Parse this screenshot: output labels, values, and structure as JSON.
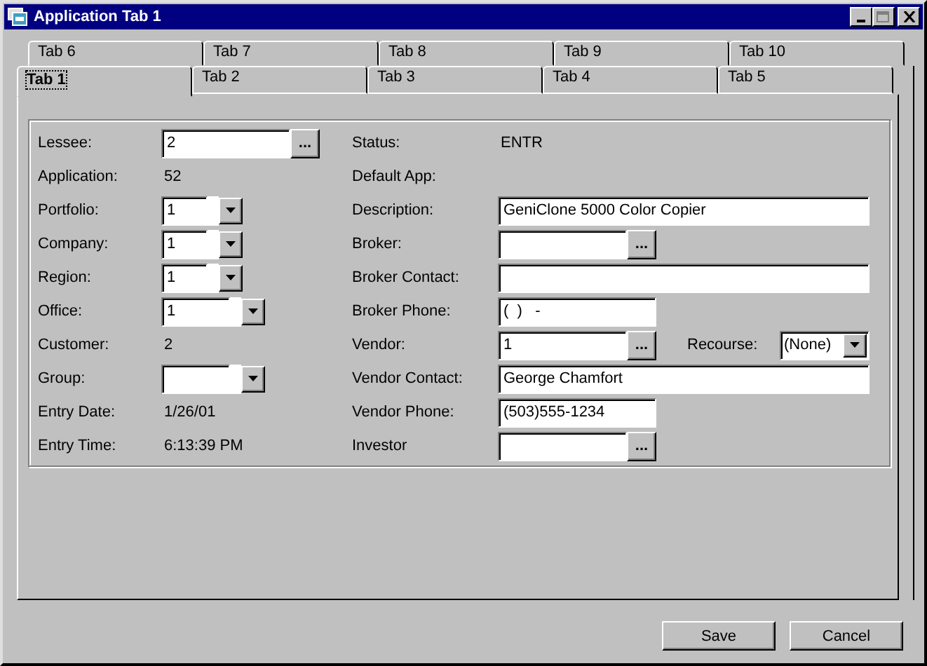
{
  "window": {
    "title": "Application Tab 1"
  },
  "tab_rows": [
    [
      {
        "label": "Tab 6",
        "selected": false
      },
      {
        "label": "Tab 7",
        "selected": false
      },
      {
        "label": "Tab 8",
        "selected": false
      },
      {
        "label": "Tab 9",
        "selected": false
      },
      {
        "label": "Tab 10",
        "selected": false
      }
    ],
    [
      {
        "label": "Tab 1",
        "selected": true
      },
      {
        "label": "Tab 2",
        "selected": false
      },
      {
        "label": "Tab 3",
        "selected": false
      },
      {
        "label": "Tab 4",
        "selected": false
      },
      {
        "label": "Tab 5",
        "selected": false
      }
    ]
  ],
  "left_fields": [
    {
      "label": "Lessee:",
      "kind": "lookup",
      "value": "2",
      "button": "..."
    },
    {
      "label": "Application:",
      "kind": "value",
      "value": "52"
    },
    {
      "label": "Portfolio:",
      "kind": "combo",
      "value": "1"
    },
    {
      "label": "Company:",
      "kind": "combo",
      "value": "1"
    },
    {
      "label": "Region:",
      "kind": "combo",
      "value": "1"
    },
    {
      "label": "Office:",
      "kind": "wide-combo",
      "value": "1"
    },
    {
      "label": "Customer:",
      "kind": "value",
      "value": "2"
    },
    {
      "label": "Group:",
      "kind": "wide-combo"
    },
    {
      "label": "Entry Date:",
      "kind": "value",
      "value": "1/26/01"
    },
    {
      "label": "Entry Time:",
      "kind": "value",
      "value": "6:13:39 PM"
    }
  ],
  "right_fields": [
    {
      "label": "Status:",
      "kind": "value",
      "value": "ENTR"
    },
    {
      "label": "Default App:",
      "kind": "value"
    },
    {
      "label": "Description:",
      "kind": "long-field",
      "value": "GeniClone 5000 Color Copier"
    },
    {
      "label": "Broker:",
      "kind": "lookup",
      "button": "..."
    },
    {
      "label": "Broker Contact:",
      "kind": "long-field"
    },
    {
      "label": "Broker Phone:",
      "kind": "short-field",
      "value": "(  )   -"
    },
    {
      "label": "Vendor:",
      "kind": "lookup",
      "value": "1",
      "button": "...",
      "extra": {
        "label": "Recourse:",
        "value": "(None)"
      }
    },
    {
      "label": "Vendor Contact:",
      "kind": "long-field",
      "value": "George Chamfort"
    },
    {
      "label": "Vendor Phone:",
      "kind": "short-field",
      "value": "(503)555-1234"
    },
    {
      "label": "Investor",
      "kind": "lookup",
      "button": "..."
    }
  ],
  "buttons": [
    "Save",
    "Cancel"
  ]
}
